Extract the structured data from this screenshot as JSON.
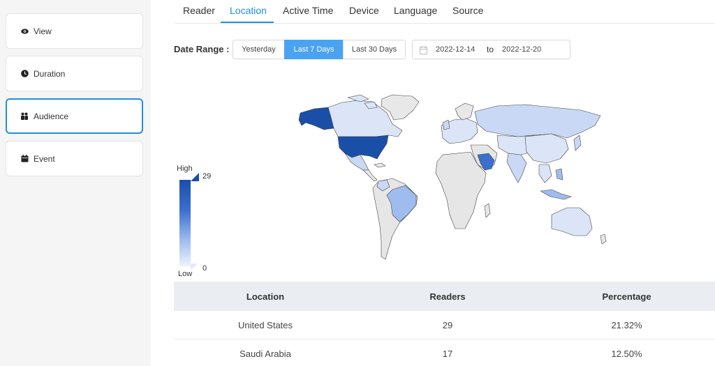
{
  "sidebar": {
    "items": [
      {
        "label": "View",
        "icon": "eye-icon",
        "active": false
      },
      {
        "label": "Duration",
        "icon": "clock-icon",
        "active": false
      },
      {
        "label": "Audience",
        "icon": "people-icon",
        "active": true
      },
      {
        "label": "Event",
        "icon": "calendar-icon",
        "active": false
      }
    ]
  },
  "tabs": [
    "Reader",
    "Location",
    "Active Time",
    "Device",
    "Language",
    "Source"
  ],
  "active_tab": "Location",
  "date_range": {
    "label": "Date Range :",
    "options": [
      "Yesterday",
      "Last 7 Days",
      "Last 30 Days"
    ],
    "selected": "Last 7 Days",
    "start": "2022-12-14",
    "separator": "to",
    "end": "2022-12-20"
  },
  "legend": {
    "high_label": "High",
    "low_label": "Low",
    "max": "29",
    "min": "0"
  },
  "table": {
    "headers": [
      "Location",
      "Readers",
      "Percentage"
    ],
    "rows": [
      [
        "United States",
        "29",
        "21.32%"
      ],
      [
        "Saudi Arabia",
        "17",
        "12.50%"
      ]
    ]
  },
  "colors": {
    "accent": "#1f8fe0",
    "tab_active": "#1f8fe0",
    "segment_active": "#4aa3f0",
    "map_high": "#1a4fa8",
    "map_low": "#eef3fd",
    "table_header_bg": "#eaedf2"
  }
}
